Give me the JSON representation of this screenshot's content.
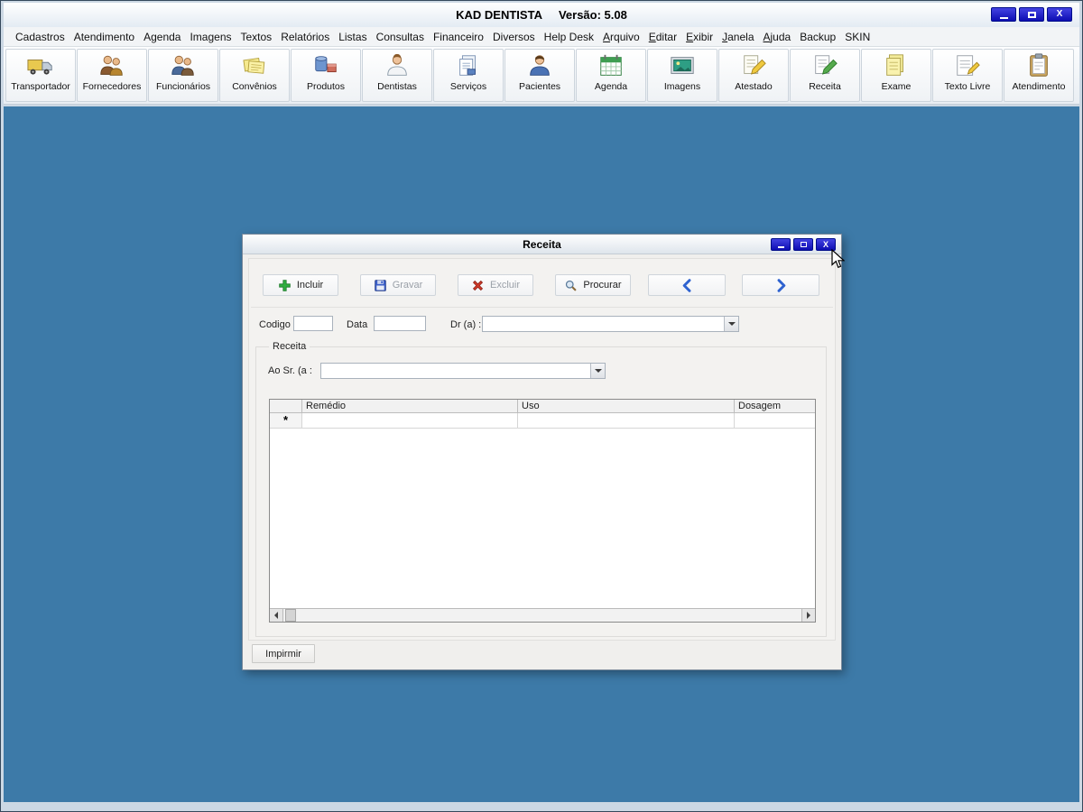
{
  "colors": {
    "desktop_blue": "#3d7aa8",
    "control_button_blue": "#1414c8"
  },
  "app": {
    "title": "KAD DENTISTA",
    "version": "Versão: 5.08",
    "close_glyph": "X"
  },
  "menu": {
    "items": [
      "Cadastros",
      "Atendimento",
      "Agenda",
      "Imagens",
      "Textos",
      "Relatórios",
      "Listas",
      "Consultas",
      "Financeiro",
      "Diversos",
      "Help Desk",
      "Arquivo",
      "Editar",
      "Exibir",
      "Janela",
      "Ajuda",
      "Backup",
      "SKIN"
    ]
  },
  "toolbar": {
    "items": [
      {
        "label": "Transportador",
        "icon": "truck-icon"
      },
      {
        "label": "Fornecedores",
        "icon": "suppliers-people-icon"
      },
      {
        "label": "Funcionários",
        "icon": "employees-people-icon"
      },
      {
        "label": "Convênios",
        "icon": "notes-icon"
      },
      {
        "label": "Produtos",
        "icon": "products-icon"
      },
      {
        "label": "Dentistas",
        "icon": "dentist-person-icon"
      },
      {
        "label": "Serviços",
        "icon": "documents-icon"
      },
      {
        "label": "Pacientes",
        "icon": "patient-person-icon"
      },
      {
        "label": "Agenda",
        "icon": "calendar-icon"
      },
      {
        "label": "Imagens",
        "icon": "picture-icon"
      },
      {
        "label": "Atestado",
        "icon": "paper-pencil-yellow-icon"
      },
      {
        "label": "Receita",
        "icon": "paper-pencil-green-icon"
      },
      {
        "label": "Exame",
        "icon": "yellow-paper-icon"
      },
      {
        "label": "Texto Livre",
        "icon": "free-text-icon"
      },
      {
        "label": "Atendimento",
        "icon": "clipboard-icon"
      }
    ]
  },
  "dialog": {
    "title": "Receita",
    "close_glyph": "X",
    "buttons": {
      "incluir": "Incluir",
      "gravar": "Gravar",
      "excluir": "Excluir",
      "procurar": "Procurar"
    },
    "fields": {
      "codigo_label": "Codigo",
      "codigo_value": "",
      "data_label": "Data",
      "data_value": "",
      "dr_label": "Dr (a) :",
      "dr_value": "",
      "group_label": "Receita",
      "ao_sr_label": "Ao Sr. (a :",
      "ao_sr_value": ""
    },
    "grid": {
      "columns": [
        "",
        "Remédio",
        "Uso",
        "Dosagem"
      ],
      "rows": [
        {
          "indicator": "*",
          "remedio": "",
          "uso": "",
          "dosagem": ""
        }
      ]
    },
    "print_label": "Impirmir"
  }
}
